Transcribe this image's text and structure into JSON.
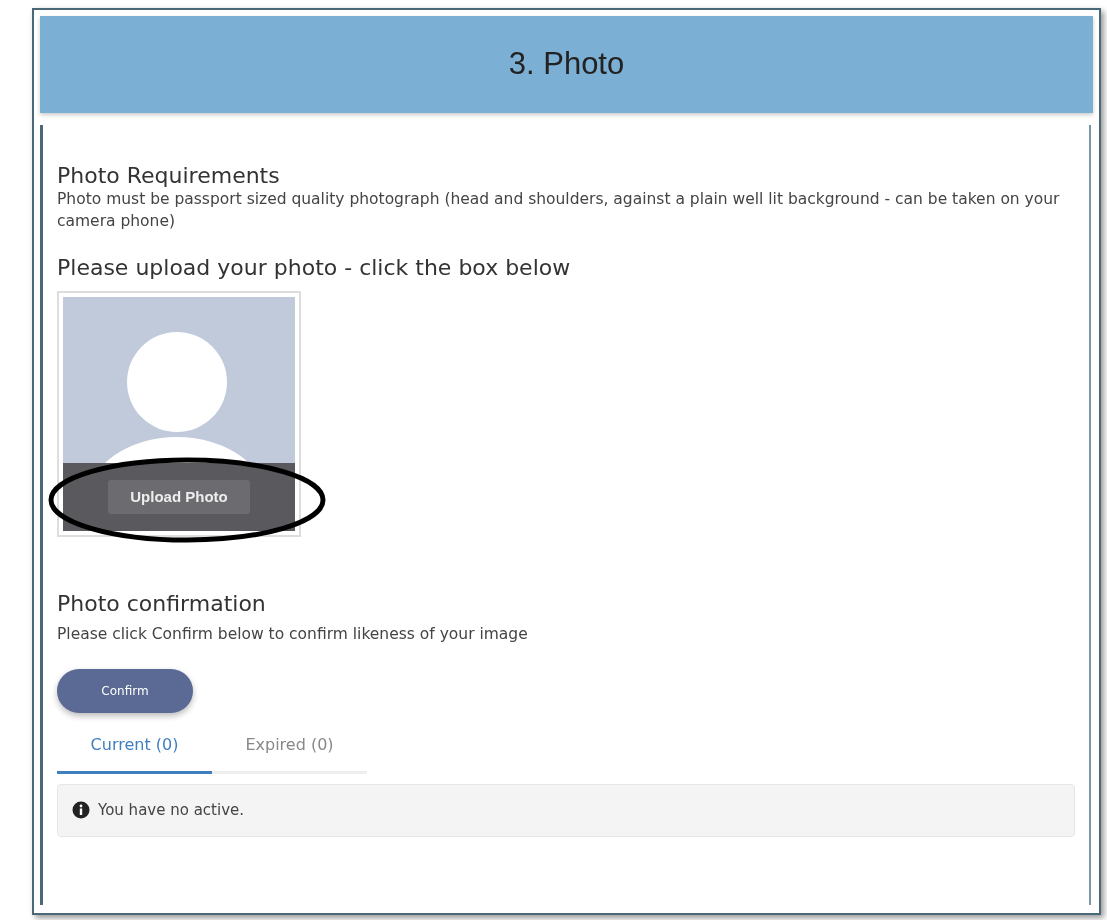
{
  "header": {
    "title": "3. Photo"
  },
  "requirements": {
    "heading": "Photo Requirements",
    "text": "Photo must be passport sized quality photograph (head and shoulders, against a plain well lit background - can be taken on your camera phone)"
  },
  "upload": {
    "heading": "Please upload your photo - click the box below",
    "button": "Upload Photo",
    "annotated": true
  },
  "confirmation": {
    "heading": "Photo confirmation",
    "text": "Please click Confirm below to confirm likeness of your image",
    "button": "Confirm"
  },
  "tabs": [
    {
      "label": "Current (0)",
      "selected": true
    },
    {
      "label": "Expired (0)",
      "selected": false
    }
  ],
  "notice": {
    "text": "You have no active."
  }
}
